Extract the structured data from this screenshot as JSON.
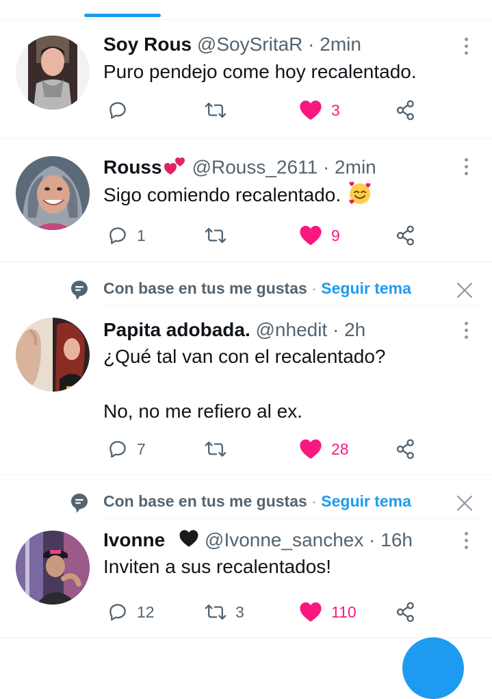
{
  "feed": {
    "tweets": [
      {
        "name": "Soy Rous",
        "handle": "@SoySritaR",
        "sep": "·",
        "time": "2min",
        "text": "Puro pendejo come hoy  recalentado.",
        "replies": "",
        "retweets": "",
        "likes": "3",
        "liked": true
      },
      {
        "name": "Rouss",
        "name_emoji": "two-hearts",
        "handle": "@Rouss_2611",
        "sep": "·",
        "time": "2min",
        "text": "Sigo comiendo recalentado.",
        "text_emoji": "smiling-face-with-hearts",
        "replies": "1",
        "retweets": "",
        "likes": "9",
        "liked": true
      },
      {
        "social_context": "Con base en tus me gustas",
        "social_sep": "·",
        "follow_topic": "Seguir tema",
        "name": "Papita adobada.",
        "handle": "@nhedit",
        "sep": "·",
        "time": "2h",
        "text": "¿Qué tal van con el recalentado?\n\nNo, no me refiero al ex.",
        "replies": "7",
        "retweets": "",
        "likes": "28",
        "liked": true
      },
      {
        "social_context": "Con base en tus me gustas",
        "social_sep": "·",
        "follow_topic": "Seguir tema",
        "name": "Ivonne",
        "name_emoji": "black-heart",
        "handle": "@Ivonne_sanchex",
        "sep": "·",
        "time": "16h",
        "text": "Inviten a sus recalentados!",
        "replies": "12",
        "retweets": "3",
        "likes": "110",
        "liked": true
      }
    ]
  },
  "colors": {
    "accent": "#1d9bf0",
    "like": "#f91880",
    "secondary_text": "#536471",
    "divider": "#eff3f4"
  },
  "icons": [
    "reply-icon",
    "retweet-icon",
    "like-icon",
    "share-icon",
    "more-icon",
    "topic-icon",
    "close-icon"
  ]
}
